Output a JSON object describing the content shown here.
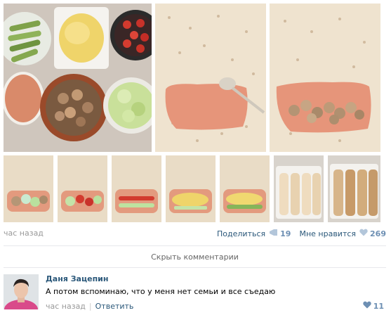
{
  "post": {
    "timestamp": "час назад",
    "share": {
      "label": "Поделиться",
      "count": "19"
    },
    "like": {
      "label": "Мне нравится",
      "count": "269"
    }
  },
  "hide_comments": "Скрыть комментарии",
  "comment": {
    "author": "Даня Зацепин",
    "text": "А потом вспоминаю, что у меня нет семьи и все съедаю",
    "timestamp": "час назад",
    "separator": "|",
    "reply_label": "Ответить",
    "likes": "11"
  },
  "icons": {
    "share": "megaphone-icon",
    "like": "heart-icon"
  },
  "colors": {
    "link": "#2b587a",
    "count": "#6d8fb3",
    "muted": "#999999",
    "divider": "#e7e8ec"
  }
}
